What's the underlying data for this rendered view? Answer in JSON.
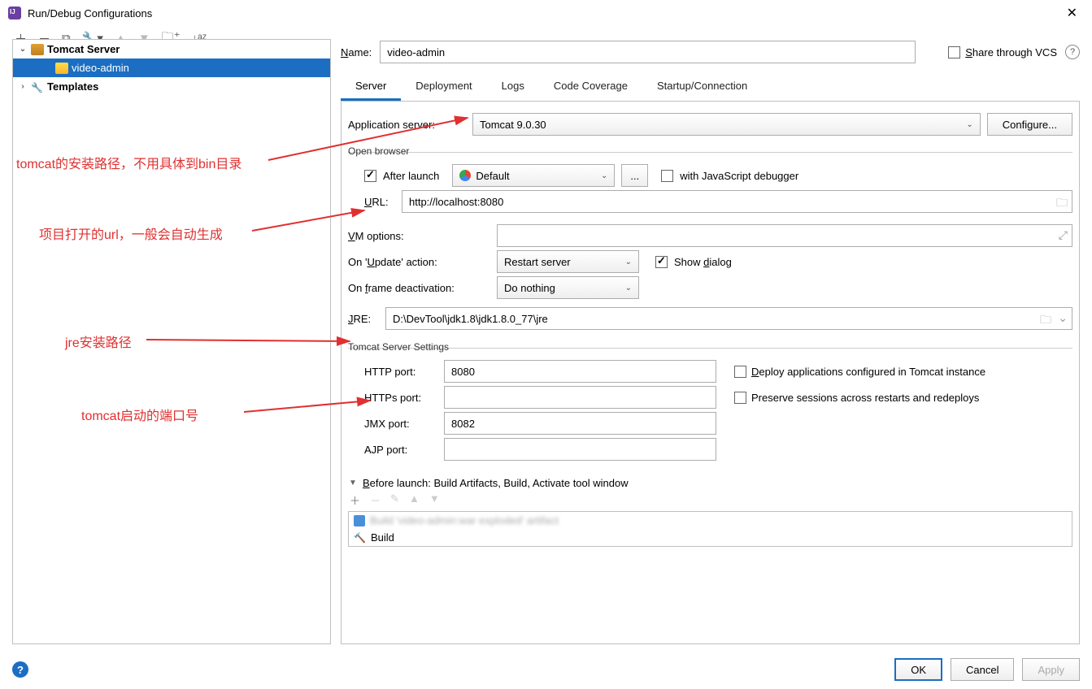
{
  "window": {
    "title": "Run/Debug Configurations"
  },
  "sidebar": {
    "tomcat_server": "Tomcat Server",
    "video_admin": "video-admin",
    "templates": "Templates"
  },
  "name_row": {
    "label_pre": "N",
    "label_post": "ame:",
    "value": "video-admin",
    "share": "S",
    "share_post": "hare through VCS"
  },
  "tabs": {
    "server": "Server",
    "deployment": "Deployment",
    "logs": "Logs",
    "coverage": "Code Coverage",
    "startup": "Startup/Connection"
  },
  "app_server": {
    "label": "Application server:",
    "value": "Tomcat 9.0.30",
    "configure": "Configure..."
  },
  "open_browser": {
    "section": "Open browser",
    "after_launch": "After launch",
    "default": "Default",
    "ellipsis": "...",
    "js_debug": "with JavaScript debugger",
    "url_lbl_u": "U",
    "url_lbl_post": "RL:",
    "url_val": "http://localhost:8080"
  },
  "vm": {
    "lbl_u": "V",
    "lbl_post": "M options:"
  },
  "update": {
    "lbl_pre": "On '",
    "lbl_u": "U",
    "lbl_post": "pdate' action:",
    "value": "Restart server",
    "show_pre": "Show ",
    "show_u": "d",
    "show_post": "ialog"
  },
  "frame": {
    "lbl_pre": "On ",
    "lbl_u": "f",
    "lbl_post": "rame deactivation:",
    "value": "Do nothing"
  },
  "jre": {
    "lbl_u": "J",
    "lbl_post": "RE:",
    "value": "D:\\DevTool\\jdk1.8\\jdk1.8.0_77\\jre"
  },
  "tomcat_settings": {
    "section": "Tomcat Server Settings",
    "http": "HTTP port:",
    "http_val": "8080",
    "https": "HTTPs port:",
    "https_val": "",
    "jmx": "JMX port:",
    "jmx_val": "8082",
    "ajp": "AJP port:",
    "ajp_val": "",
    "deploy_u": "D",
    "deploy_post": "eploy applications configured in Tomcat instance",
    "preserve": "Preserve sessions across restarts and redeploys"
  },
  "before_launch": {
    "header_u": "B",
    "header_post": "efore launch: Build Artifacts, Build, Activate tool window",
    "build": "Build"
  },
  "buttons": {
    "ok": "OK",
    "cancel": "Cancel",
    "apply": "Apply"
  },
  "annotations": {
    "a1": "tomcat的安装路径，不用具体到bin目录",
    "a2": "项目打开的url，一般会自动生成",
    "a3": "jre安装路径",
    "a4": "tomcat启动的端口号"
  }
}
